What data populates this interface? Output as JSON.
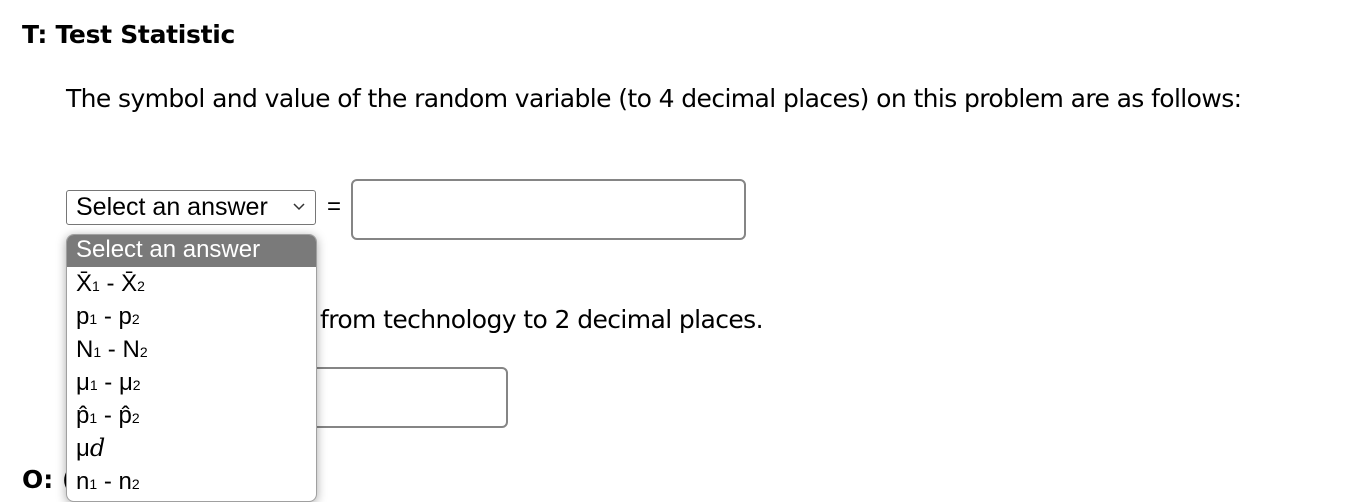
{
  "section": {
    "heading": "T: Test Statistic",
    "prompt": "The symbol and value of the random variable (to 4 decimal places) on this problem are as follows:",
    "prompt_pvalue": "from technology to 2 decimal places.",
    "next_heading_partial": "O: ("
  },
  "symbol_select": {
    "selected": "Select an answer",
    "equals": "=",
    "value": "",
    "options": [
      {
        "label": "Select an answer",
        "main1": "Select an answer"
      },
      {
        "label": "X̄₁ - X̄₂",
        "main1": "X̄",
        "sub1": "1",
        "sep": " - ",
        "main2": "X̄",
        "sub2": "2"
      },
      {
        "label": "p₁ - p₂",
        "main1": "p",
        "sub1": "1",
        "sep": " - ",
        "main2": "p",
        "sub2": "2"
      },
      {
        "label": "N₁ - N₂",
        "main1": "N",
        "sub1": "1",
        "sep": " - ",
        "main2": "N",
        "sub2": "2"
      },
      {
        "label": "μ₁ - μ₂",
        "main1": "μ",
        "sub1": "1",
        "sep": " - ",
        "main2": "μ",
        "sub2": "2"
      },
      {
        "label": "p̂₁ - p̂₂",
        "main1": "p̂",
        "sub1": "1",
        "sep": " - ",
        "main2": "p̂",
        "sub2": "2"
      },
      {
        "label": "μd",
        "main1": "μ",
        "italic": "d"
      },
      {
        "label": "n₁ - n₂",
        "main1": "n",
        "sub1": "1",
        "sep": " - ",
        "main2": "n",
        "sub2": "2"
      }
    ]
  },
  "pvalue_input": {
    "value": ""
  },
  "colors": {
    "selected_option_bg": "#7a7a7a",
    "input_border": "#858585"
  }
}
